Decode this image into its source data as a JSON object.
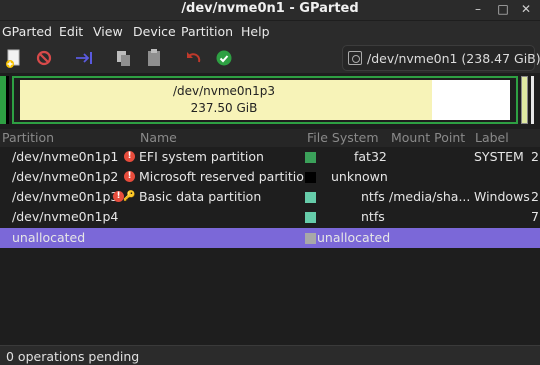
{
  "window": {
    "title": "/dev/nvme0n1 - GParted",
    "min": "–",
    "max": "□",
    "close": "✕"
  },
  "menu": [
    "GParted",
    "Edit",
    "View",
    "Device",
    "Partition",
    "Help"
  ],
  "toolbar": {
    "icons": [
      "new-icon",
      "delete-icon",
      "resize-move-icon",
      "copy-icon",
      "paste-icon",
      "undo-icon",
      "apply-icon"
    ],
    "device_selector": "/dev/nvme0n1 (238.47 GiB)"
  },
  "disk_map": {
    "partition_name": "/dev/nvme0n1p3",
    "partition_size": "237.50 GiB"
  },
  "columns": [
    "Partition",
    "Name",
    "File System",
    "Mount Point",
    "Label"
  ],
  "rows": [
    {
      "partition": "/dev/nvme0n1p1",
      "warning": "!",
      "key": "",
      "name": "EFI system partition",
      "fs": "fat32",
      "mount": "",
      "label": "SYSTEM",
      "extra": "2",
      "fs_color": "#3ba15a"
    },
    {
      "partition": "/dev/nvme0n1p2",
      "warning": "!",
      "key": "",
      "name": "Microsoft reserved partition",
      "fs": "unknown",
      "mount": "",
      "label": "",
      "extra": "",
      "fs_color": "#000000"
    },
    {
      "partition": "/dev/nvme0n1p3",
      "warning": "!",
      "key": "🔑",
      "name": "Basic data partition",
      "fs": "ntfs",
      "mount": "/media/sha...",
      "label": "Windows",
      "extra": "2",
      "fs_color": "#66ccaa"
    },
    {
      "partition": "/dev/nvme0n1p4",
      "warning": "",
      "key": "",
      "name": "",
      "fs": "ntfs",
      "mount": "",
      "label": "",
      "extra": "7",
      "fs_color": "#66ccaa"
    },
    {
      "partition": "unallocated",
      "warning": "",
      "key": "",
      "name": "",
      "fs": "unallocated",
      "mount": "",
      "label": "",
      "extra": "",
      "fs_color": "#a8a8a8"
    }
  ],
  "status": "0 operations pending"
}
